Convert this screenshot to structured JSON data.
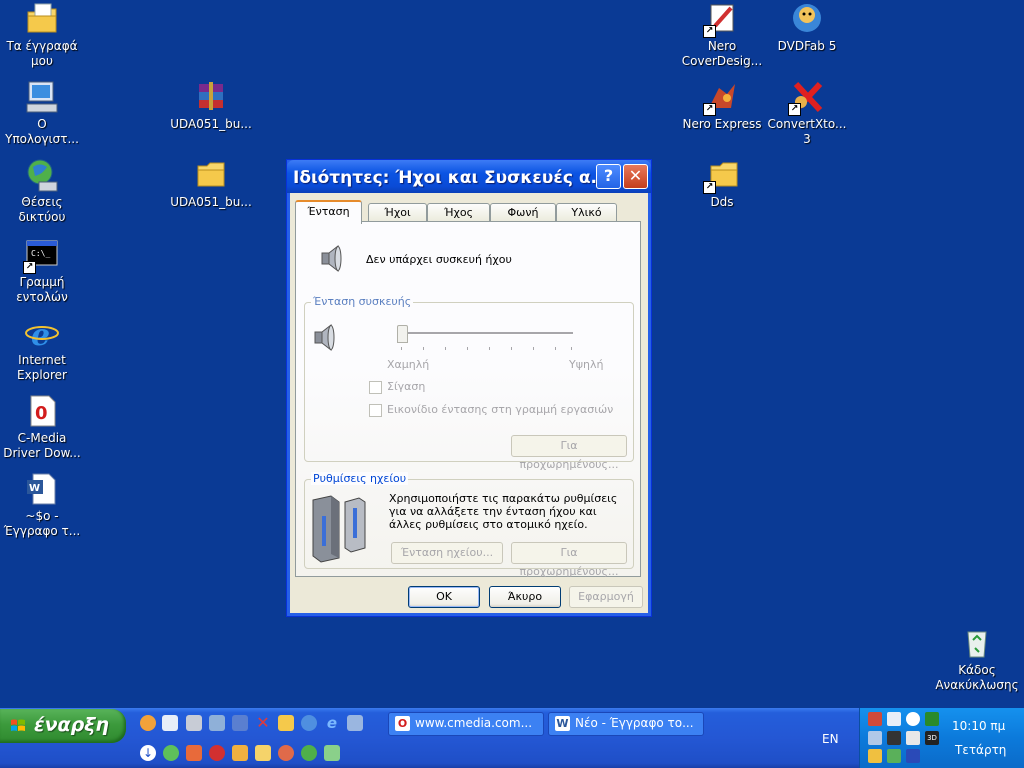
{
  "desktop": {
    "icons": [
      {
        "label": "Τα έγγραφά\nμου"
      },
      {
        "label": "Ο\nΥπολογιστ..."
      },
      {
        "label": "Θέσεις\nδικτύου"
      },
      {
        "label": "Γραμμή\nεντολών"
      },
      {
        "label": "Internet\nExplorer"
      },
      {
        "label": "C-Media\nDriver Dow..."
      },
      {
        "label": "~$ο -\nΈγγραφο τ..."
      },
      {
        "label": "UDA051_bu..."
      },
      {
        "label": "UDA051_bu..."
      },
      {
        "label": "Nero\nCoverDesig..."
      },
      {
        "label": "DVDFab 5"
      },
      {
        "label": "Nero Express"
      },
      {
        "label": "ConvertXto...\n3"
      },
      {
        "label": "Dds"
      },
      {
        "label": "Κάδος\nΑνακύκλωσης"
      }
    ]
  },
  "dialog": {
    "title": "Ιδιότητες: Ήχοι και Συσκευές α...",
    "help_label": "?",
    "close_label": "✕",
    "tabs": [
      "Ένταση",
      "Ήχοι",
      "Ήχος",
      "Φωνή",
      "Υλικό"
    ],
    "no_device_text": "Δεν υπάρχει συσκευή ήχου",
    "device_volume": {
      "legend": "Ένταση συσκευής",
      "low_label": "Χαμηλή",
      "high_label": "Υψηλή",
      "level": 0,
      "mute_label": "Σίγαση",
      "tray_icon_label": "Εικονίδιο έντασης στη γραμμή εργασιών",
      "advanced_label": "Για προχωρημένους..."
    },
    "speaker_settings": {
      "legend": "Ρυθμίσεις ηχείου",
      "description": "Χρησιμοποιήστε τις παρακάτω ρυθμίσεις για να αλλάξετε την ένταση ήχου και άλλες ρυθμίσεις στο ατομικό ηχείο.",
      "speaker_volume_label": "Ένταση ηχείου...",
      "advanced_label": "Για προχωρημένους..."
    },
    "buttons": {
      "ok": "OK",
      "cancel": "Άκυρο",
      "apply": "Εφαρμογή"
    }
  },
  "taskbar": {
    "start_label": "έναρξη",
    "tasks": [
      "www.cmedia.com...",
      "Νέο - Έγγραφο το..."
    ],
    "language": "EN",
    "clock": "10:10 πμ",
    "day": "Τετάρτη"
  },
  "colors": {
    "desktop": "#0a3a95",
    "dialog_bg": "#ece9d8",
    "title_blue": "#0b54e3",
    "start_green": "#3c9a3c"
  }
}
